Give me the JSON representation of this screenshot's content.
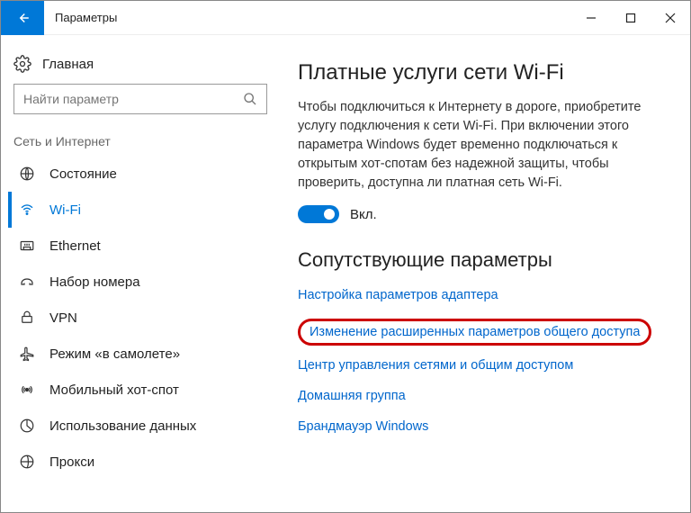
{
  "window": {
    "title": "Параметры"
  },
  "sidebar": {
    "home": "Главная",
    "search_placeholder": "Найти параметр",
    "category": "Сеть и Интернет",
    "items": [
      {
        "label": "Состояние"
      },
      {
        "label": "Wi-Fi"
      },
      {
        "label": "Ethernet"
      },
      {
        "label": "Набор номера"
      },
      {
        "label": "VPN"
      },
      {
        "label": "Режим «в самолете»"
      },
      {
        "label": "Мобильный хот-спот"
      },
      {
        "label": "Использование данных"
      },
      {
        "label": "Прокси"
      }
    ]
  },
  "main": {
    "section_title": "Платные услуги сети Wi-Fi",
    "section_desc": "Чтобы подключиться к Интернету в дороге, приобретите услугу подключения к сети Wi-Fi. При включении этого параметра Windows будет временно подключаться к открытым хот-спотам без надежной защиты, чтобы проверить, доступна ли платная сеть Wi-Fi.",
    "toggle_label": "Вкл.",
    "related_title": "Сопутствующие параметры",
    "links": [
      "Настройка параметров адаптера",
      "Изменение расширенных параметров общего доступа",
      "Центр управления сетями и общим доступом",
      "Домашняя группа",
      "Брандмауэр Windows"
    ]
  }
}
